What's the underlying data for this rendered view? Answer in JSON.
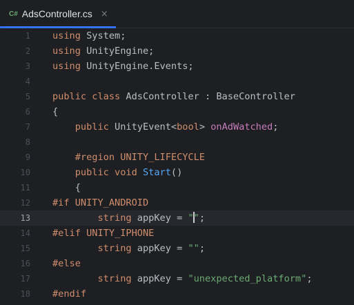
{
  "tab": {
    "lang_badge": "C#",
    "title": "AdsController.cs",
    "close_glyph": "×"
  },
  "colors": {
    "background": "#1e1f22",
    "accent": "#3574f0",
    "keyword": "#cf8e6d",
    "string": "#6aab73",
    "event": "#c77dbb",
    "method": "#56a8f5"
  },
  "lines": [
    {
      "n": "1",
      "t": [
        [
          "kw",
          "using"
        ],
        [
          "plain",
          " System;"
        ]
      ]
    },
    {
      "n": "2",
      "t": [
        [
          "kw",
          "using"
        ],
        [
          "plain",
          " UnityEngine;"
        ]
      ]
    },
    {
      "n": "3",
      "t": [
        [
          "kw",
          "using"
        ],
        [
          "plain",
          " UnityEngine.Events;"
        ]
      ]
    },
    {
      "n": "4",
      "t": []
    },
    {
      "n": "5",
      "t": [
        [
          "kw",
          "public class"
        ],
        [
          "plain",
          " AdsController : BaseController"
        ]
      ]
    },
    {
      "n": "6",
      "t": [
        [
          "plain",
          "{"
        ]
      ]
    },
    {
      "n": "7",
      "t": [
        [
          "plain",
          "    "
        ],
        [
          "kw",
          "public"
        ],
        [
          "plain",
          " UnityEvent<"
        ],
        [
          "kw",
          "bool"
        ],
        [
          "plain",
          "> "
        ],
        [
          "ev",
          "onAdWatched"
        ],
        [
          "plain",
          ";"
        ]
      ]
    },
    {
      "n": "8",
      "t": []
    },
    {
      "n": "9",
      "t": [
        [
          "plain",
          "    "
        ],
        [
          "pp",
          "#region UNITY_LIFECYCLE"
        ]
      ]
    },
    {
      "n": "10",
      "t": [
        [
          "plain",
          "    "
        ],
        [
          "kw",
          "public void"
        ],
        [
          "plain",
          " "
        ],
        [
          "fn",
          "Start"
        ],
        [
          "plain",
          "()"
        ]
      ]
    },
    {
      "n": "11",
      "t": [
        [
          "plain",
          "    {"
        ]
      ]
    },
    {
      "n": "12",
      "t": [
        [
          "pp",
          "#if UNITY_ANDROID"
        ]
      ]
    },
    {
      "n": "13",
      "t": [
        [
          "plain",
          "        "
        ],
        [
          "kw",
          "string"
        ],
        [
          "plain",
          " appKey = "
        ],
        [
          "str",
          "\""
        ],
        [
          "caret",
          ""
        ],
        [
          "str",
          "\""
        ],
        [
          "plain",
          ";"
        ]
      ],
      "current": true
    },
    {
      "n": "14",
      "t": [
        [
          "pp",
          "#elif UNITY_IPHONE"
        ]
      ]
    },
    {
      "n": "15",
      "t": [
        [
          "plain",
          "        "
        ],
        [
          "kw",
          "string"
        ],
        [
          "plain",
          " appKey = "
        ],
        [
          "str",
          "\"\""
        ],
        [
          "plain",
          ";"
        ]
      ]
    },
    {
      "n": "16",
      "t": [
        [
          "pp",
          "#else"
        ]
      ]
    },
    {
      "n": "17",
      "t": [
        [
          "plain",
          "        "
        ],
        [
          "kw",
          "string"
        ],
        [
          "plain",
          " appKey = "
        ],
        [
          "str",
          "\"unexpected_platform\""
        ],
        [
          "plain",
          ";"
        ]
      ]
    },
    {
      "n": "18",
      "t": [
        [
          "pp",
          "#endif"
        ]
      ]
    }
  ]
}
